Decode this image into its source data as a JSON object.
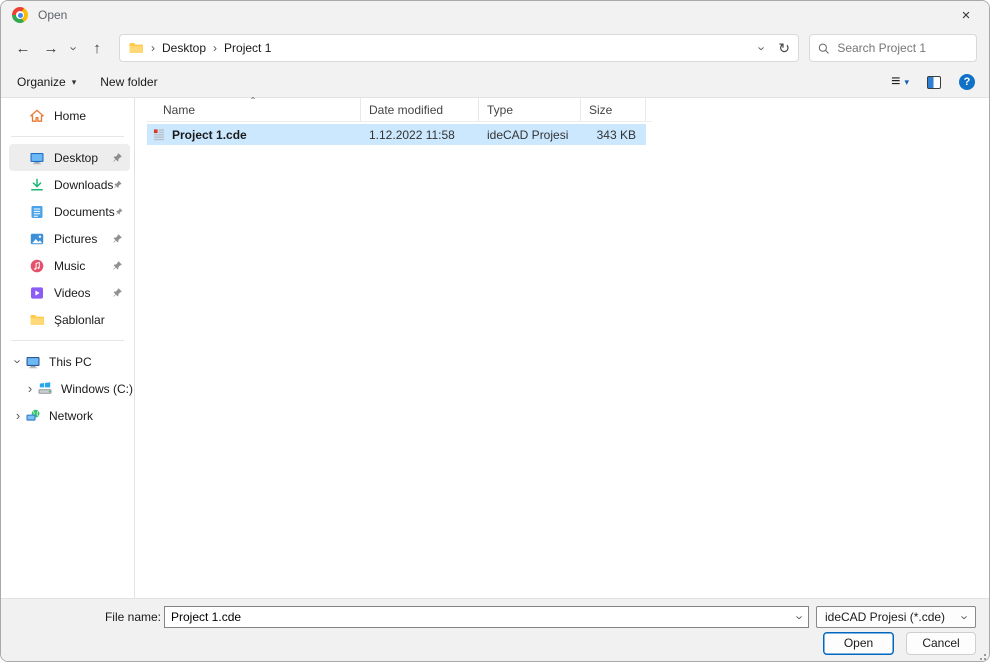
{
  "window": {
    "title": "Open"
  },
  "icons": {
    "back": "←",
    "forward": "→",
    "up": "↑",
    "refresh": "↻",
    "close": "×",
    "breadcrumb_separator": "›",
    "chevron": "›",
    "caret_down": "▾",
    "list_view": "≡",
    "sort_ascending": "ˆ",
    "help": "?"
  },
  "navbar": {
    "breadcrumb": [
      "Desktop",
      "Project 1"
    ],
    "search_placeholder": "Search Project 1"
  },
  "toolbar": {
    "organize_label": "Organize",
    "new_folder_label": "New folder"
  },
  "sidebar": {
    "items": [
      {
        "label": "Home",
        "pinned": false
      },
      {
        "label": "Desktop",
        "pinned": true,
        "selected": true
      },
      {
        "label": "Downloads",
        "pinned": true
      },
      {
        "label": "Documents",
        "pinned": true
      },
      {
        "label": "Pictures",
        "pinned": true
      },
      {
        "label": "Music",
        "pinned": true
      },
      {
        "label": "Videos",
        "pinned": true
      },
      {
        "label": "Şablonlar",
        "pinned": false
      }
    ],
    "tree": [
      {
        "label": "This PC",
        "expanded": true
      },
      {
        "label": "Windows (C:)",
        "expanded": false
      },
      {
        "label": "Network",
        "expanded": false
      }
    ]
  },
  "filelist": {
    "columns": [
      "Name",
      "Date modified",
      "Type",
      "Size"
    ],
    "rows": [
      {
        "name": "Project 1.cde",
        "date_modified": "1.12.2022 11:58",
        "type": "ideCAD Projesi",
        "size": "343 KB",
        "selected": true
      }
    ]
  },
  "footer": {
    "file_name_label": "File name:",
    "file_name_value": "Project 1.cde",
    "file_type_value": "ideCAD Projesi (*.cde)",
    "open_label": "Open",
    "cancel_label": "Cancel"
  },
  "colors": {
    "accent": "#0067c0",
    "selection": "#cce8ff",
    "sidebar_selected": "#ededed"
  }
}
